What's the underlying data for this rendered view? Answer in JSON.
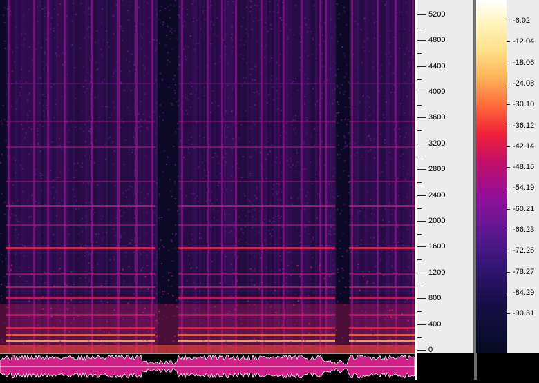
{
  "frequency_axis": {
    "ticks": [
      "5200",
      "4800",
      "4400",
      "4000",
      "3600",
      "3200",
      "2800",
      "2400",
      "2000",
      "1600",
      "1200",
      "800",
      "400",
      "0"
    ],
    "values": [
      5200,
      4800,
      4400,
      4000,
      3600,
      3200,
      2800,
      2400,
      2000,
      1600,
      1200,
      800,
      400,
      0
    ]
  },
  "colorbar": {
    "labels": [
      "-6.02",
      "-12.04",
      "-18.06",
      "-24.08",
      "-30.10",
      "-36.12",
      "-42.14",
      "-48.16",
      "-54.19",
      "-60.21",
      "-66.23",
      "-72.25",
      "-78.27",
      "-84.29",
      "-90.31"
    ],
    "values": [
      -6.02,
      -12.04,
      -18.06,
      -24.08,
      -30.1,
      -36.12,
      -42.14,
      -48.16,
      -54.19,
      -60.21,
      -66.23,
      -72.25,
      -78.27,
      -84.29,
      -90.31
    ]
  },
  "colors": {
    "background": "#0b0a24",
    "low": "#140c3a",
    "mid": "#7a1490",
    "high": "#e8205a",
    "peak": "#ffe080",
    "waveform": "#d0208a"
  }
}
